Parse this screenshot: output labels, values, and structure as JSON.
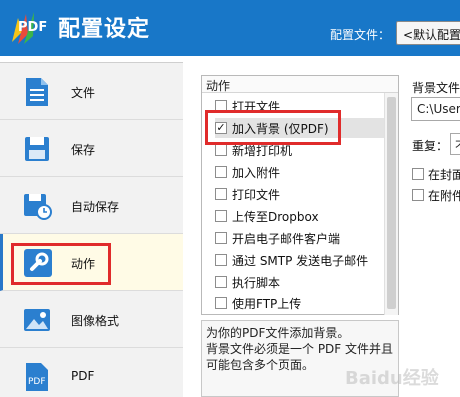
{
  "header": {
    "logo_text": "PDF",
    "title": "配置设定",
    "config_label": "配置文件：",
    "config_value": "<默认配置>"
  },
  "sidebar": {
    "items": [
      {
        "label": "文件",
        "icon": "document-icon"
      },
      {
        "label": "保存",
        "icon": "floppy-disk-icon"
      },
      {
        "label": "自动保存",
        "icon": "auto-save-clock-icon"
      },
      {
        "label": "动作",
        "icon": "wrench-icon",
        "active": true
      },
      {
        "label": "图像格式",
        "icon": "image-icon"
      },
      {
        "label": "PDF",
        "icon": "pdf-file-icon"
      }
    ]
  },
  "actions": {
    "header": "动作",
    "items": [
      {
        "label": "打开文件",
        "checked": false
      },
      {
        "label": "加入背景 (仅PDF)",
        "checked": true,
        "selected": true
      },
      {
        "label": "新增打印机",
        "checked": false
      },
      {
        "label": "加入附件",
        "checked": false
      },
      {
        "label": "打印文件",
        "checked": false
      },
      {
        "label": "上传至Dropbox",
        "checked": false
      },
      {
        "label": "开启电子邮件客户端",
        "checked": false
      },
      {
        "label": "通过 SMTP 发送电子邮件",
        "checked": false
      },
      {
        "label": "执行脚本",
        "checked": false
      },
      {
        "label": "使用FTP上传",
        "checked": false
      }
    ]
  },
  "description": {
    "lines": [
      "为你的PDF文件添加背景。",
      "背景文件必须是一个 PDF 文件并且",
      "可能包含多个页面。"
    ]
  },
  "right_panel": {
    "background_file_label": "背景文件",
    "background_file_value": "C:\\Users",
    "repeat_label": "重复：",
    "repeat_value": "不",
    "on_cover_label": "在封面",
    "on_attachment_label": "在附件"
  },
  "watermark": "Baidu经验",
  "colors": {
    "header_bg": "#1877c8",
    "highlight_red": "#e02b2b",
    "active_sidebar_bg": "#fffbe6"
  }
}
